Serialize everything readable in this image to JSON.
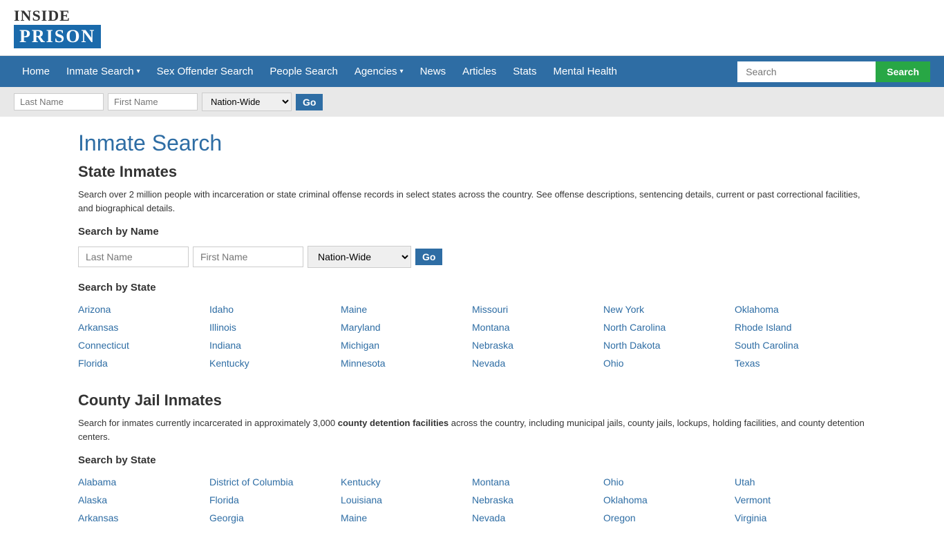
{
  "logo": {
    "top": "INSIDE",
    "bottom": "PRISON"
  },
  "nav": {
    "items": [
      {
        "label": "Home",
        "href": "#",
        "dropdown": false
      },
      {
        "label": "Inmate Search",
        "href": "#",
        "dropdown": true
      },
      {
        "label": "Sex Offender Search",
        "href": "#",
        "dropdown": false
      },
      {
        "label": "People Search",
        "href": "#",
        "dropdown": false
      },
      {
        "label": "Agencies",
        "href": "#",
        "dropdown": true
      },
      {
        "label": "News",
        "href": "#",
        "dropdown": false
      },
      {
        "label": "Articles",
        "href": "#",
        "dropdown": false
      },
      {
        "label": "Stats",
        "href": "#",
        "dropdown": false
      },
      {
        "label": "Mental Health",
        "href": "#",
        "dropdown": false
      }
    ],
    "search_placeholder": "Search",
    "search_button": "Search"
  },
  "quick_search": {
    "last_name_placeholder": "Last Name",
    "first_name_placeholder": "First Name",
    "scope_default": "Nation-Wide",
    "go_label": "Go"
  },
  "main": {
    "page_title": "Inmate Search",
    "state_section": {
      "title": "State Inmates",
      "desc": "Search over 2 million people with incarceration or state criminal offense records in select states across the country. See offense descriptions, sentencing details, current or past correctional facilities, and biographical details.",
      "search_by_name_label": "Search by Name",
      "last_name_placeholder": "Last Name",
      "first_name_placeholder": "First Name",
      "scope_default": "Nation-Wide",
      "go_label": "Go",
      "search_by_state_label": "Search by State",
      "states": [
        [
          "Arizona",
          "Idaho",
          "Maine",
          "Missouri",
          "New York",
          "Oklahoma"
        ],
        [
          "Arkansas",
          "Illinois",
          "Maryland",
          "Montana",
          "North Carolina",
          "Rhode Island"
        ],
        [
          "Connecticut",
          "Indiana",
          "Michigan",
          "Nebraska",
          "North Dakota",
          "South Carolina"
        ],
        [
          "Florida",
          "Kentucky",
          "Minnesota",
          "Nevada",
          "Ohio",
          "Texas"
        ]
      ]
    },
    "county_section": {
      "title": "County Jail Inmates",
      "desc_part1": "Search for inmates currently incarcerated in approximately 3,000 ",
      "desc_bold": "county detention facilities",
      "desc_part2": " across the country, including municipal jails, county jails, lockups, holding facilities, and county detention centers.",
      "search_by_state_label": "Search by State",
      "states": [
        [
          "Alabama",
          "District of Columbia",
          "Kentucky",
          "Montana",
          "Ohio",
          "Utah"
        ],
        [
          "Alaska",
          "Florida",
          "Louisiana",
          "Nebraska",
          "Oklahoma",
          "Vermont"
        ],
        [
          "Arkansas",
          "Georgia",
          "Maine",
          "Nevada",
          "Oregon",
          "Virginia"
        ]
      ]
    }
  }
}
